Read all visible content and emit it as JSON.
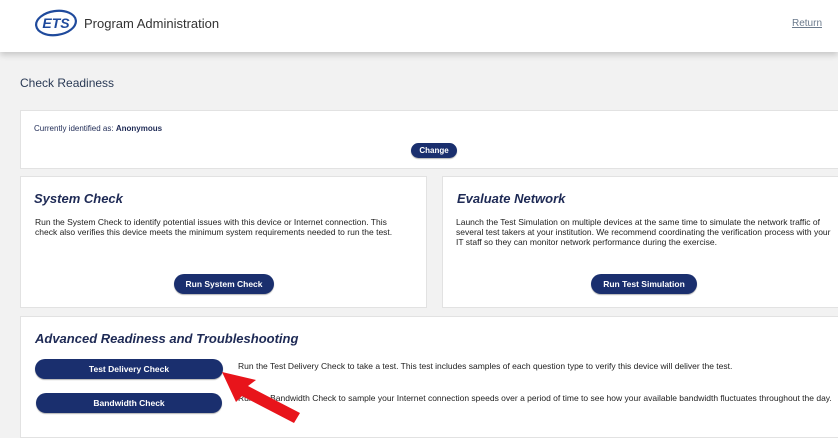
{
  "header": {
    "logo_text": "ETS",
    "title": "Program Administration",
    "return_label": "Return"
  },
  "page": {
    "title": "Check Readiness"
  },
  "identity": {
    "label": "Currently identified as:",
    "name": "Anonymous",
    "change_label": "Change"
  },
  "system_check": {
    "title": "System Check",
    "description": "Run the System Check to identify potential issues with this device or Internet connection. This check also verifies this device meets the minimum system requirements needed to run the test.",
    "button_label": "Run System Check"
  },
  "evaluate_network": {
    "title": "Evaluate Network",
    "description": "Launch the Test Simulation on multiple devices at the same time to simulate the network traffic of several test takers at your institution. We recommend coordinating the verification process with your IT staff so they can monitor network performance during the exercise.",
    "button_label": "Run Test Simulation"
  },
  "advanced": {
    "title": "Advanced Readiness and Troubleshooting",
    "items": [
      {
        "button_label": "Test Delivery Check",
        "description": "Run the Test Delivery Check to take a test. This test includes samples of each question type to verify this device will deliver the test."
      },
      {
        "button_label": "Bandwidth Check",
        "description": "Run the Bandwidth Check to sample your Internet connection speeds over a period of time to see how your available bandwidth fluctuates throughout the day."
      }
    ]
  },
  "colors": {
    "button_bg": "#1a2f6e",
    "title_text": "#1e2a55",
    "annotation_arrow": "#e8141b"
  }
}
